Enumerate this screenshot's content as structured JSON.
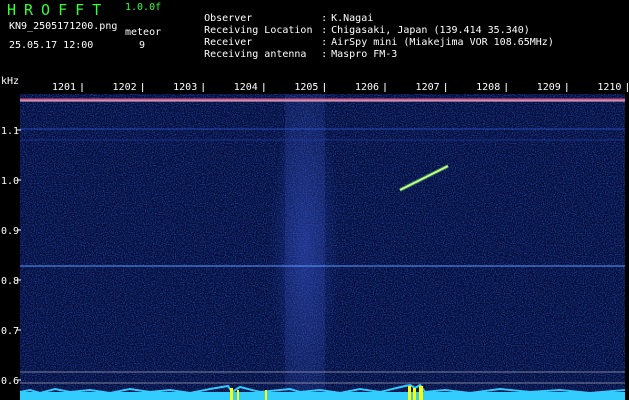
{
  "header": {
    "app_title": "HROFFT",
    "version": "1.0.0f",
    "filename": "KN9_2505171200.png",
    "datetime": "25.05.17 12:00",
    "meteor_label": "meteor",
    "meteor_count": "9"
  },
  "info": [
    {
      "key": "Observer",
      "value": "K.Nagai"
    },
    {
      "key": "Receiving Location",
      "value": "Chigasaki, Japan (139.414 35.340)"
    },
    {
      "key": "Receiver",
      "value": "AirSpy mini (Miakejima VOR 108.65MHz)"
    },
    {
      "key": "Receiving antenna",
      "value": "Maspro FM-3"
    }
  ],
  "separator": ":",
  "axes": {
    "y_unit": "kHz",
    "y_ticks": [
      "1.1",
      "1.0",
      "0.9",
      "0.8",
      "0.7",
      "0.6"
    ],
    "x_ticks": [
      "1201",
      "1202",
      "1203",
      "1204",
      "1205",
      "1206",
      "1207",
      "1208",
      "1209",
      "1210"
    ]
  },
  "colors": {
    "background": "#000000",
    "title": "#33ff33",
    "noise": "#0a1a8a",
    "axis": "#ffffff",
    "power_trace": "#33ccff",
    "echo": "#ffff00"
  }
}
